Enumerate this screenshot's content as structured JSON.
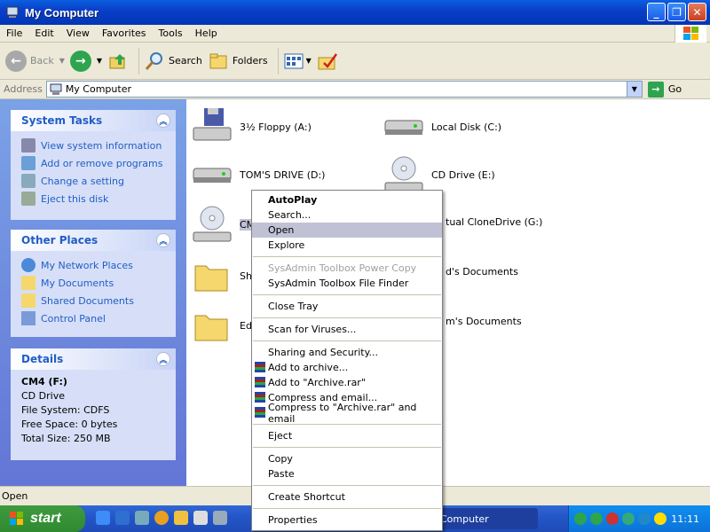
{
  "window": {
    "title": "My Computer"
  },
  "menu": [
    "File",
    "Edit",
    "View",
    "Favorites",
    "Tools",
    "Help"
  ],
  "toolbar": {
    "back": "Back",
    "search": "Search",
    "folders": "Folders"
  },
  "address": {
    "label": "Address",
    "value": "My Computer",
    "go": "Go"
  },
  "tasks": {
    "title": "System Tasks",
    "items": [
      "View system information",
      "Add or remove programs",
      "Change a setting",
      "Eject this disk"
    ]
  },
  "places": {
    "title": "Other Places",
    "items": [
      "My Network Places",
      "My Documents",
      "Shared Documents",
      "Control Panel"
    ]
  },
  "details": {
    "title": "Details",
    "name": "CM4 (F:)",
    "type": "CD Drive",
    "fs": "File System: CDFS",
    "free": "Free Space: 0 bytes",
    "total": "Total Size: 250 MB"
  },
  "drives": {
    "floppy": "3½ Floppy (A:)",
    "local": "Local Disk (C:)",
    "toms": "TOM'S DRIVE (D:)",
    "cd": "CD Drive (E:)",
    "cm4": "CM",
    "clone": "tual CloneDrive (G:)",
    "sha": "Sha",
    "edsdocs": "d's Documents",
    "ed": "Ed'",
    "tomsdocs": "m's Documents"
  },
  "context_menu": {
    "autoplay": "AutoPlay",
    "search": "Search...",
    "open": "Open",
    "explore": "Explore",
    "powercopy": "SysAdmin Toolbox Power Copy",
    "finder": "SysAdmin Toolbox File Finder",
    "closetray": "Close Tray",
    "scan": "Scan for Viruses...",
    "sharing": "Sharing and Security...",
    "addarchive": "Add to archive...",
    "addrar": "Add to \"Archive.rar\"",
    "compressemail": "Compress and email...",
    "compressrar": "Compress to \"Archive.rar\" and email",
    "eject": "Eject",
    "copy": "Copy",
    "paste": "Paste",
    "shortcut": "Create Shortcut",
    "properties": "Properties"
  },
  "status": {
    "text": "Open"
  },
  "taskbar": {
    "start": "start",
    "task": "Computer",
    "clock": "11:11"
  }
}
